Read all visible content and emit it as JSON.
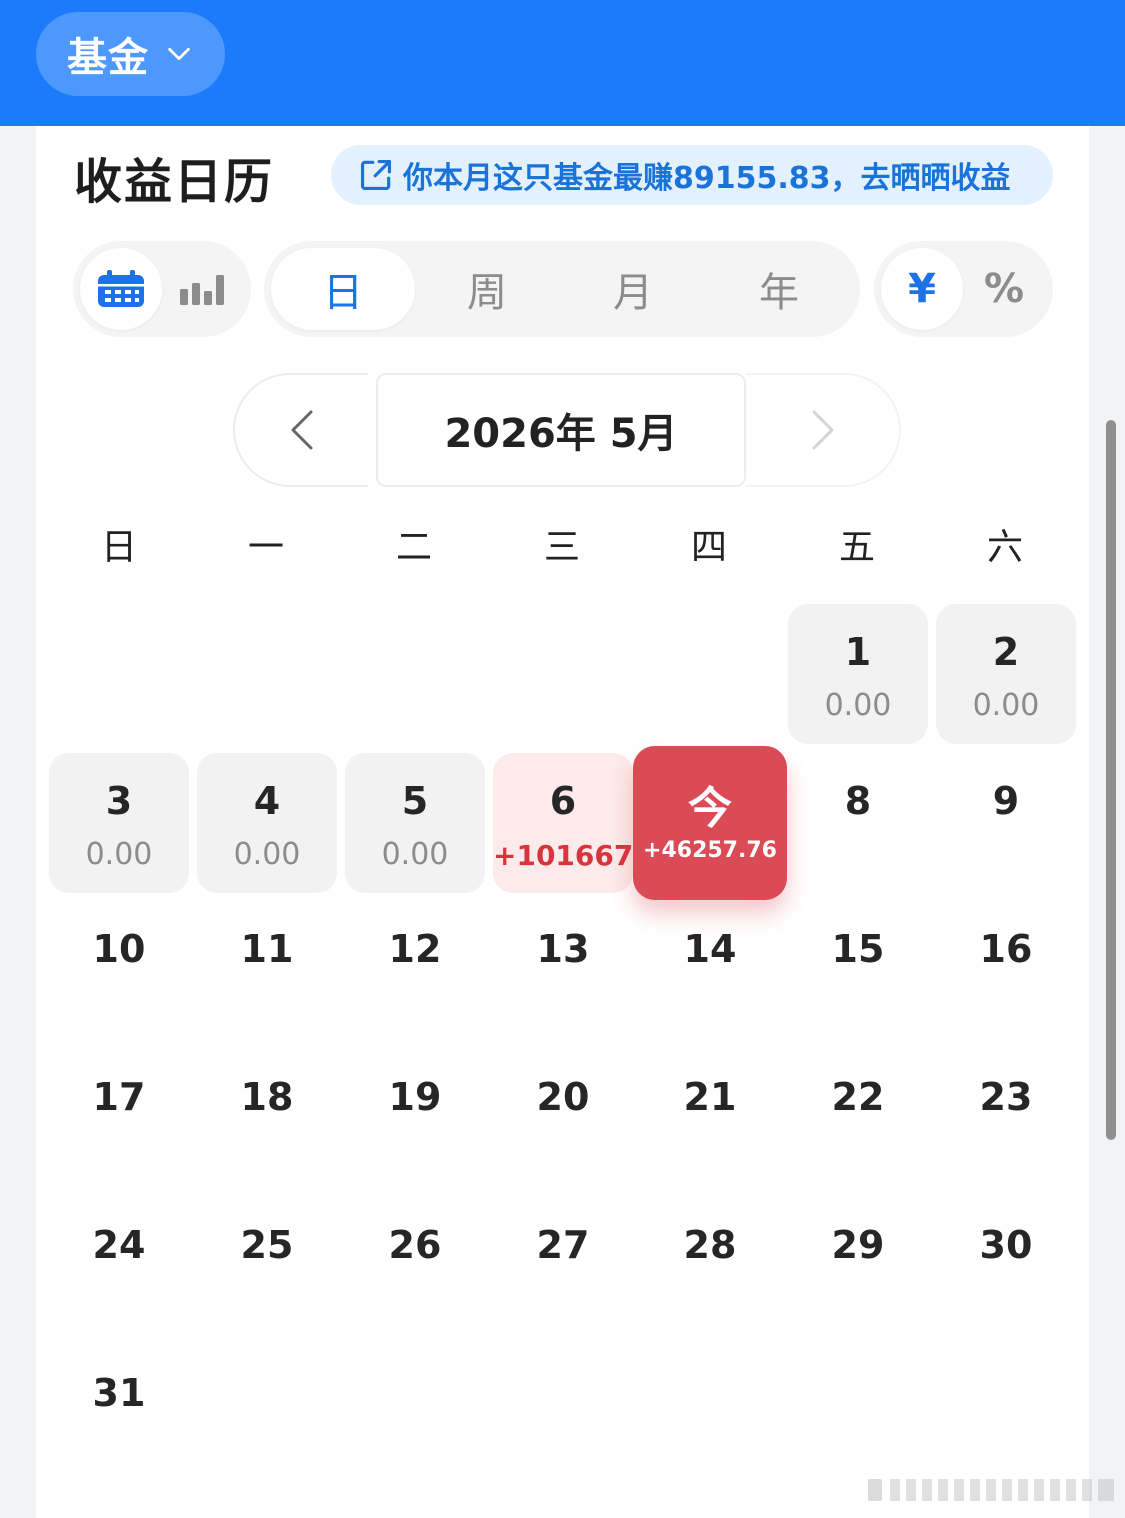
{
  "topbar": {
    "fund_label": "基金",
    "chevron_icon": "chevron-down-icon"
  },
  "header": {
    "title": "收益日历",
    "share_text": "你本月这只基金最赚89155.83，去晒晒收益",
    "share_icon": "external-link-icon"
  },
  "view_toggle": {
    "calendar_icon": "calendar-icon",
    "chart_icon": "bar-chart-icon"
  },
  "period_tabs": [
    {
      "label": "日",
      "active": true
    },
    {
      "label": "周",
      "active": false
    },
    {
      "label": "月",
      "active": false
    },
    {
      "label": "年",
      "active": false
    }
  ],
  "unit_toggle": [
    {
      "label": "¥",
      "active": true
    },
    {
      "label": "%",
      "active": false
    }
  ],
  "month_nav": {
    "label": "2026年 5月",
    "prev_icon": "chevron-left-icon",
    "next_icon": "chevron-right-icon"
  },
  "weekdays": [
    "日",
    "一",
    "二",
    "三",
    "四",
    "五",
    "六"
  ],
  "days_with_values": [
    {
      "day": "1",
      "value": "0.00"
    },
    {
      "day": "2",
      "value": "0.00"
    },
    {
      "day": "3",
      "value": "0.00"
    },
    {
      "day": "4",
      "value": "0.00"
    },
    {
      "day": "5",
      "value": "0.00"
    },
    {
      "day": "6",
      "value": "+101667"
    }
  ],
  "today": {
    "label": "今",
    "value": "+46257.76"
  },
  "other_days": [
    "8",
    "9",
    "10",
    "11",
    "12",
    "13",
    "14",
    "15",
    "16",
    "17",
    "18",
    "19",
    "20",
    "21",
    "22",
    "23",
    "24",
    "25",
    "26",
    "27",
    "28",
    "29",
    "30",
    "31"
  ],
  "colors": {
    "primary": "#1c7bfb",
    "gain": "#d8343e",
    "today_bg": "#db4b55"
  }
}
